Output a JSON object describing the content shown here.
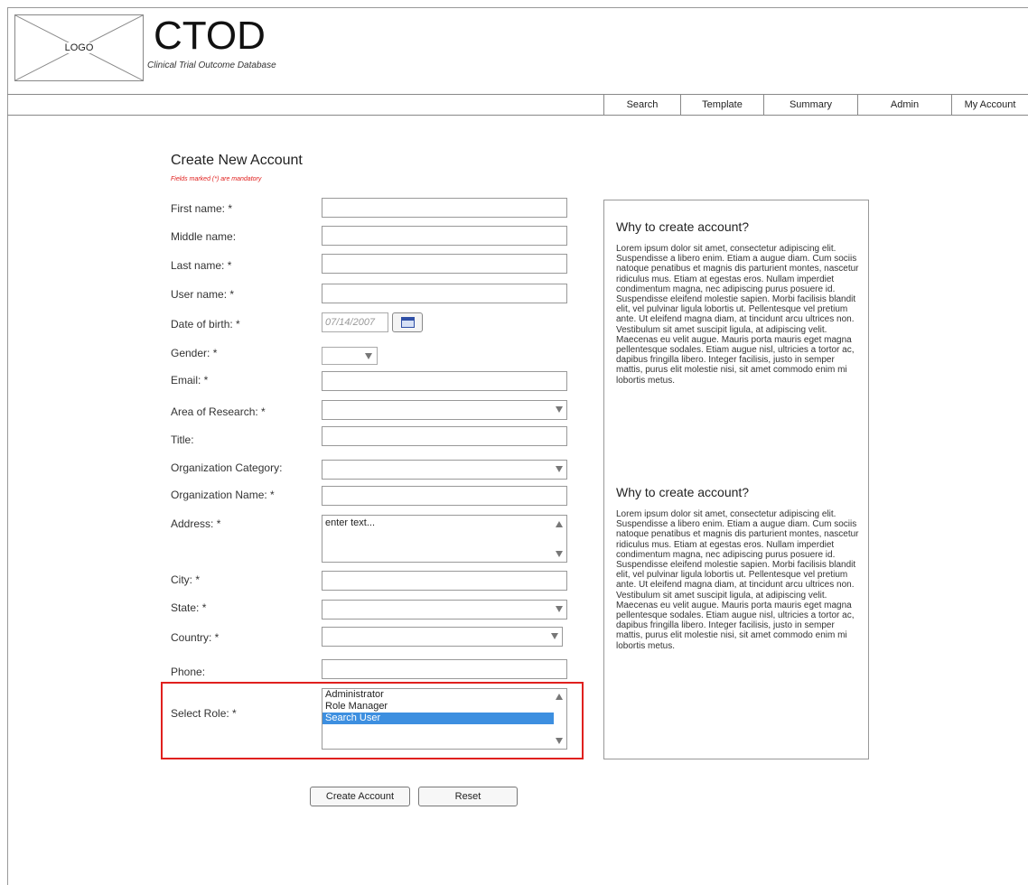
{
  "header": {
    "logo_label": "LOGO",
    "app_title": "CTOD",
    "app_subtitle": "Clinical Trial Outcome Database"
  },
  "nav": {
    "items": [
      "Search",
      "Template",
      "Summary",
      "Admin",
      "My Account"
    ]
  },
  "form": {
    "title": "Create New Account",
    "mandatory_note": "Fields marked (*) are mandatory",
    "labels": {
      "first_name": "First name: *",
      "middle_name": "Middle name:",
      "last_name": "Last name: *",
      "user_name": "User name: *",
      "dob": "Date of birth: *",
      "gender": "Gender: *",
      "email": "Email: *",
      "area": "Area of Research: *",
      "title": "Title:",
      "org_category": "Organization Category:",
      "org_name": "Organization Name: *",
      "address": "Address: *",
      "city": "City: *",
      "state": "State: *",
      "country": "Country: *",
      "phone": "Phone:",
      "role": "Select Role: *"
    },
    "dob_placeholder": "07/14/2007",
    "address_placeholder": "enter text...",
    "roles": [
      "Administrator",
      "Role Manager",
      "Search User"
    ],
    "selected_role": "Search User",
    "highlight_color": "#e0201e",
    "selection_color": "#3d8fe0"
  },
  "buttons": {
    "create": "Create Account",
    "reset": "Reset"
  },
  "sidebar": {
    "sections": [
      {
        "heading": "Why to create account?",
        "body": "Lorem ipsum dolor sit amet, consectetur adipiscing elit. Suspendisse a libero enim. Etiam a augue diam. Cum sociis natoque penatibus et magnis dis parturient montes, nascetur ridiculus mus. Etiam at egestas eros. Nullam imperdiet condimentum magna, nec adipiscing purus posuere id. Suspendisse eleifend molestie sapien. Morbi facilisis blandit elit, vel pulvinar ligula lobortis ut. Pellentesque vel pretium ante. Ut eleifend magna diam, at tincidunt arcu ultrices non. Vestibulum sit amet suscipit ligula, at adipiscing velit. Maecenas eu velit augue. Mauris porta mauris eget magna pellentesque sodales. Etiam augue nisl, ultricies a tortor ac, dapibus fringilla libero. Integer facilisis, justo in semper mattis, purus elit molestie nisi, sit amet commodo enim mi lobortis metus."
      },
      {
        "heading": "Why to create account?",
        "body": "Lorem ipsum dolor sit amet, consectetur adipiscing elit. Suspendisse a libero enim. Etiam a augue diam. Cum sociis natoque penatibus et magnis dis parturient montes, nascetur ridiculus mus. Etiam at egestas eros. Nullam imperdiet condimentum magna, nec adipiscing purus posuere id. Suspendisse eleifend molestie sapien. Morbi facilisis blandit elit, vel pulvinar ligula lobortis ut. Pellentesque vel pretium ante. Ut eleifend magna diam, at tincidunt arcu ultrices non. Vestibulum sit amet suscipit ligula, at adipiscing velit. Maecenas eu velit augue. Mauris porta mauris eget magna pellentesque sodales. Etiam augue nisl, ultricies a tortor ac, dapibus fringilla libero. Integer facilisis, justo in semper mattis, purus elit molestie nisi, sit amet commodo enim mi lobortis metus."
      }
    ]
  }
}
